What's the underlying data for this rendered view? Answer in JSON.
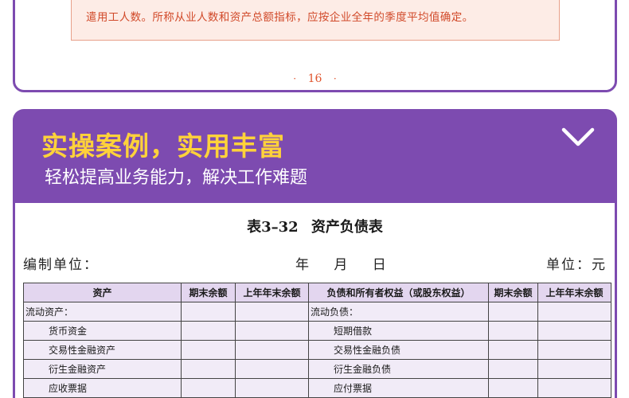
{
  "top_card": {
    "note": "遣用工人数。所称从业人数和资产总额指标，应按企业全年的季度平均值确定。",
    "page_dot_left": "·",
    "page_number": "16",
    "page_dot_right": "·"
  },
  "banner": {
    "headline": "实操案例，实用丰富",
    "subline": "轻松提高业务能力，解决工作难题",
    "toggle_icon": "chevron-down-icon"
  },
  "document": {
    "table_title": "表3–32  资产负债表",
    "unit_label": "编制单位：",
    "date_label": "年  月  日",
    "currency_label": "单位：元"
  },
  "balance_sheet": {
    "headers": [
      "资产",
      "期末余额",
      "上年年末余额",
      "负债和所有者权益（或股东权益）",
      "期末余额",
      "上年年末余额"
    ],
    "rows": [
      {
        "asset": "流动资产：",
        "asset_end": "",
        "asset_prev": "",
        "liab": "流动负债：",
        "liab_end": "",
        "liab_prev": ""
      },
      {
        "asset": "货币资金",
        "asset_end": "",
        "asset_prev": "",
        "liab": "短期借款",
        "liab_end": "",
        "liab_prev": ""
      },
      {
        "asset": "交易性金融资产",
        "asset_end": "",
        "asset_prev": "",
        "liab": "交易性金融负债",
        "liab_end": "",
        "liab_prev": ""
      },
      {
        "asset": "衍生金融资产",
        "asset_end": "",
        "asset_prev": "",
        "liab": "衍生金融负债",
        "liab_end": "",
        "liab_prev": ""
      },
      {
        "asset": "应收票据",
        "asset_end": "",
        "asset_prev": "",
        "liab": "应付票据",
        "liab_end": "",
        "liab_prev": ""
      }
    ]
  },
  "colors": {
    "brand_purple": "#7d4bb0",
    "headline_yellow": "#ffd23a",
    "note_red": "#d14a2a",
    "table_header_bg": "#e3d6ef",
    "table_cell_bg": "#f1ebf7"
  }
}
